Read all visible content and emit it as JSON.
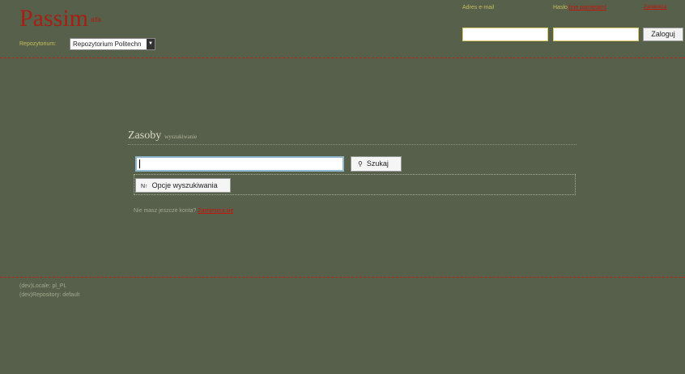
{
  "header": {
    "logo": "Passim",
    "logo_sup": "alfa",
    "repository_label": "Repozytorium:",
    "repository_selected": "Repozytorium Politechn"
  },
  "login": {
    "email_label": "Adres e-mail",
    "password_label": "Hasło",
    "forgot_link": "[nie pamiętam]",
    "register_link": "Zarejestruj",
    "login_button": "Zaloguj"
  },
  "main": {
    "title": "Zasoby",
    "subtitle": "wyszukiwanie",
    "search_button": "Szukaj",
    "options_button": "Opcje wyszukiwania",
    "no_account_text": "Nie masz jeszcze konta?",
    "register_link": "Zarejestruj się"
  },
  "footer": {
    "locale": "(dev)Locale: pl_PL",
    "repository": "(dev)Repository: default"
  },
  "icons": {
    "search": "search-icon",
    "options": "sort-icon",
    "dropdown": "chevron-down-icon"
  },
  "colors": {
    "background": "#56604a",
    "brand": "#a51f12",
    "label": "#c8bd5e",
    "link": "#c4150a"
  }
}
